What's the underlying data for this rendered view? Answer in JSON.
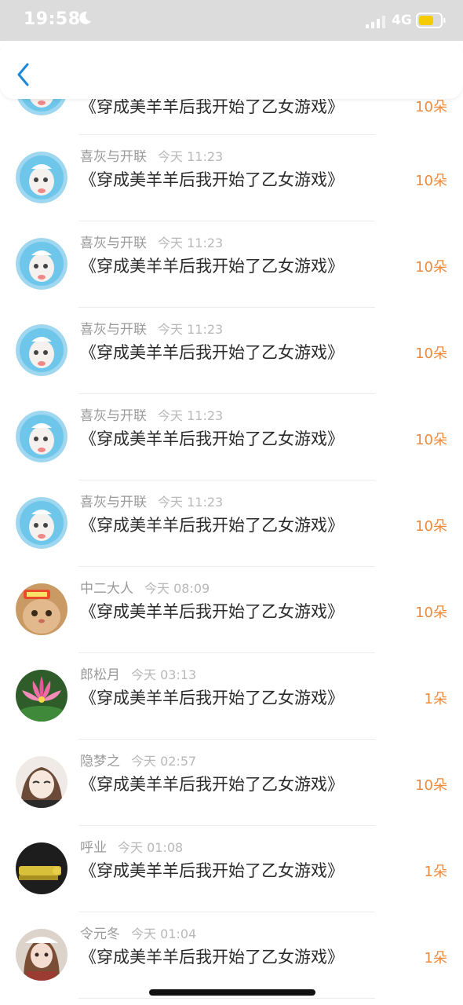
{
  "status_bar": {
    "time": "19:58",
    "network": "4G",
    "battery_color": "#f5cc00"
  },
  "nav": {
    "back_icon": "chevron-left-icon",
    "accent_color": "#1e88d6"
  },
  "list": {
    "items": [
      {
        "name": "",
        "time": "",
        "title": "《穿成美羊羊后我开始了乙女游戏》",
        "count": "10朵",
        "avatar": "sheep-cartoon"
      },
      {
        "name": "喜灰与开联",
        "time": "今天 11:23",
        "title": "《穿成美羊羊后我开始了乙女游戏》",
        "count": "10朵",
        "avatar": "sheep-cartoon"
      },
      {
        "name": "喜灰与开联",
        "time": "今天 11:23",
        "title": "《穿成美羊羊后我开始了乙女游戏》",
        "count": "10朵",
        "avatar": "sheep-cartoon"
      },
      {
        "name": "喜灰与开联",
        "time": "今天 11:23",
        "title": "《穿成美羊羊后我开始了乙女游戏》",
        "count": "10朵",
        "avatar": "sheep-cartoon"
      },
      {
        "name": "喜灰与开联",
        "time": "今天 11:23",
        "title": "《穿成美羊羊后我开始了乙女游戏》",
        "count": "10朵",
        "avatar": "sheep-cartoon"
      },
      {
        "name": "喜灰与开联",
        "time": "今天 11:23",
        "title": "《穿成美羊羊后我开始了乙女游戏》",
        "count": "10朵",
        "avatar": "sheep-cartoon"
      },
      {
        "name": "中二大人",
        "time": "今天 08:09",
        "title": "《穿成美羊羊后我开始了乙女游戏》",
        "count": "10朵",
        "avatar": "cat-photo"
      },
      {
        "name": "郎松月",
        "time": "今天 03:13",
        "title": "《穿成美羊羊后我开始了乙女游戏》",
        "count": "1朵",
        "avatar": "lotus-photo"
      },
      {
        "name": "隐梦之",
        "time": "今天 02:57",
        "title": "《穿成美羊羊后我开始了乙女游戏》",
        "count": "10朵",
        "avatar": "anime-girl-sketch"
      },
      {
        "name": "呼业",
        "time": "今天 01:08",
        "title": "《穿成美羊羊后我开始了乙女游戏》",
        "count": "1朵",
        "avatar": "dark-object-photo"
      },
      {
        "name": "令元冬",
        "time": "今天 01:04",
        "title": "《穿成美羊羊后我开始了乙女游戏》",
        "count": "1朵",
        "avatar": "doll-photo"
      }
    ]
  }
}
